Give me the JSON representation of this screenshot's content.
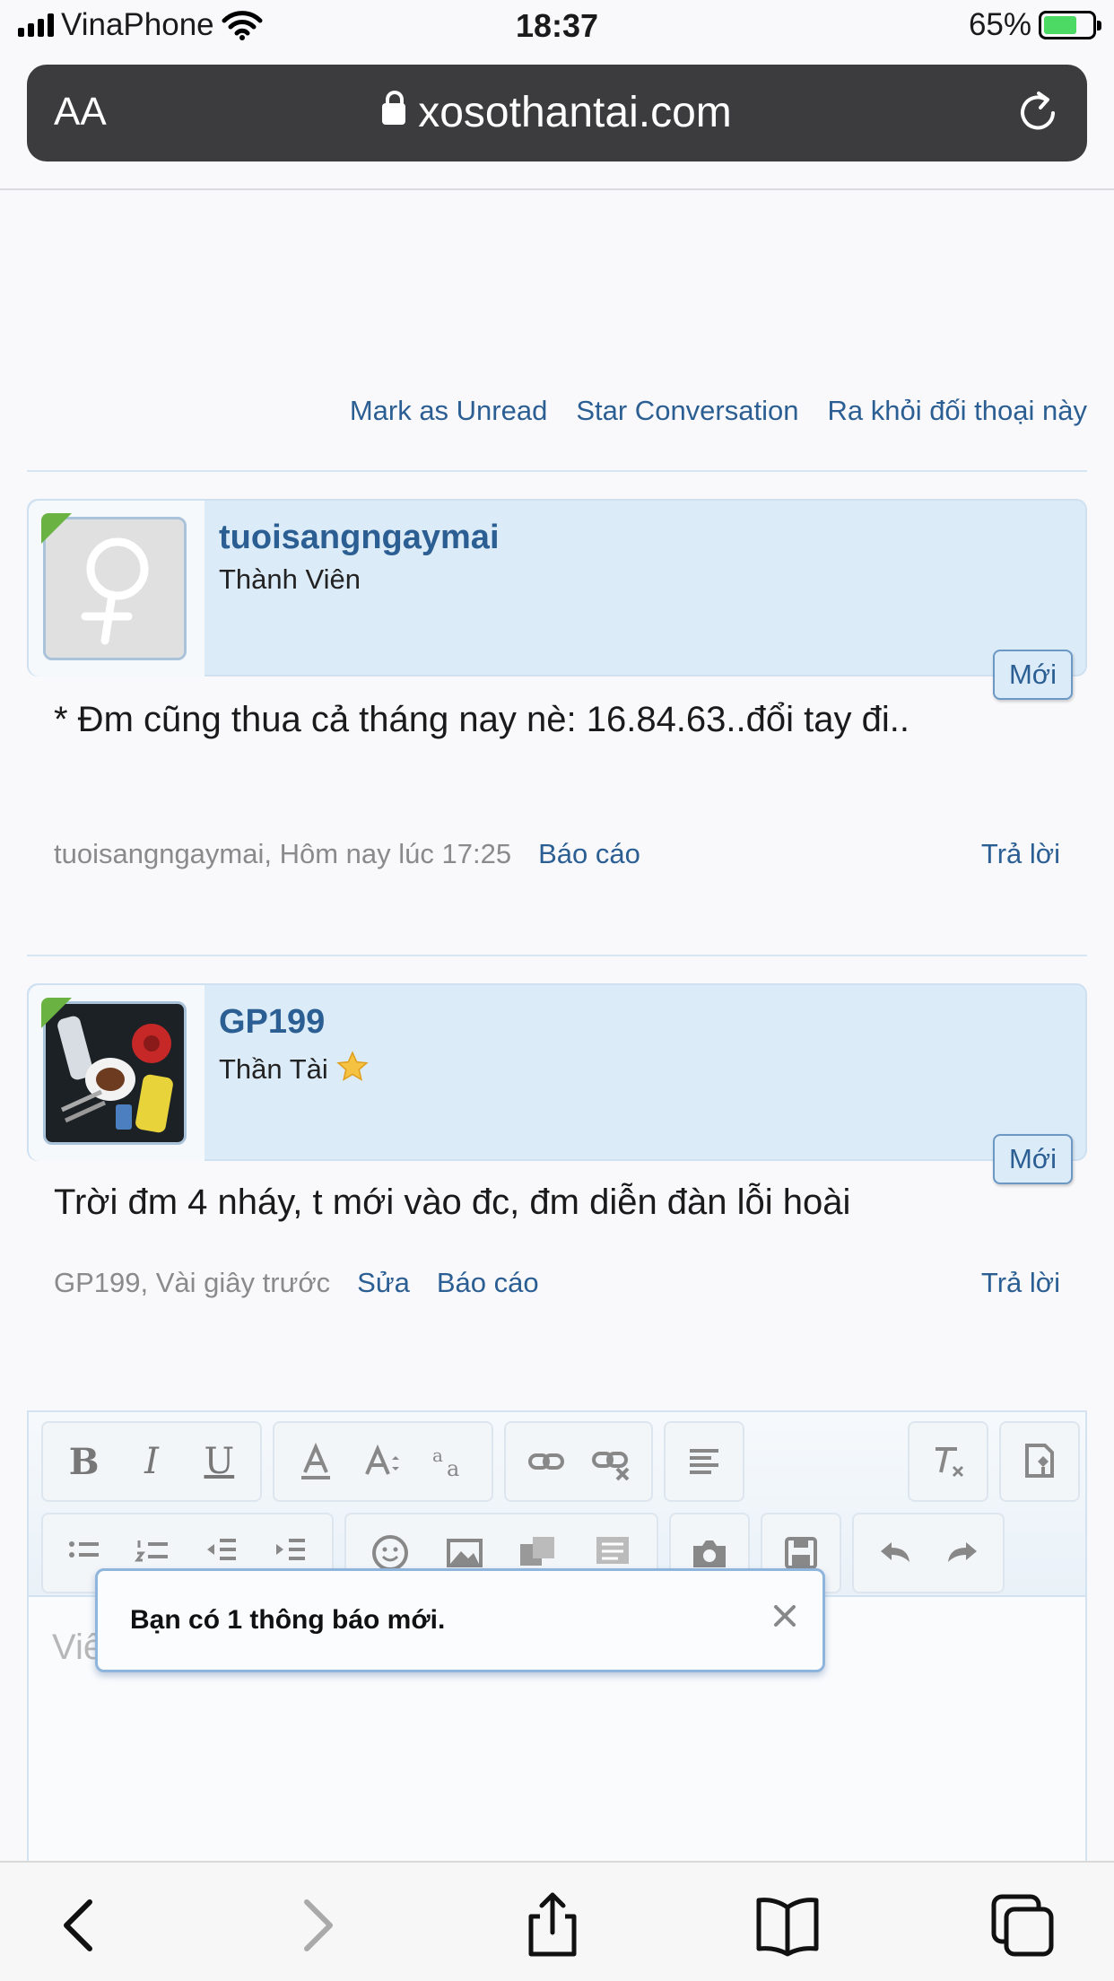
{
  "status_bar": {
    "carrier": "VinaPhone",
    "time": "18:37",
    "battery": "65%"
  },
  "browser": {
    "text_size_label": "AA",
    "url": "xosothantai.com"
  },
  "conversation_actions": {
    "mark_unread": "Mark as Unread",
    "star": "Star Conversation",
    "leave": "Ra khỏi đối thoại này"
  },
  "messages": [
    {
      "username": "tuoisangngaymai",
      "role": "Thành Viên",
      "badge": "Mới",
      "body": "* Đm cũng thua cả tháng nay nè: 16.84.63..đổi tay đi..",
      "meta": "tuoisangngaymai, Hôm nay lúc 17:25",
      "report": "Báo cáo",
      "reply": "Trả lời"
    },
    {
      "username": "GP199",
      "role": "Thần Tài",
      "badge": "Mới",
      "body": "Trời đm 4 nháy, t mới vào đc, đm diễn đàn lỗi hoài",
      "meta": "GP199, Vài giây trước",
      "edit": "Sửa",
      "report": "Báo cáo",
      "reply": "Trả lời"
    }
  ],
  "editor": {
    "placeholder": "Viết trả lời...",
    "bold": "B",
    "italic": "I",
    "underline": "U"
  },
  "notification": {
    "text": "Bạn có 1 thông báo mới."
  },
  "colors": {
    "link": "#2b5e92",
    "header_bg": "#dcebf8",
    "online_corner": "#6ab342"
  }
}
